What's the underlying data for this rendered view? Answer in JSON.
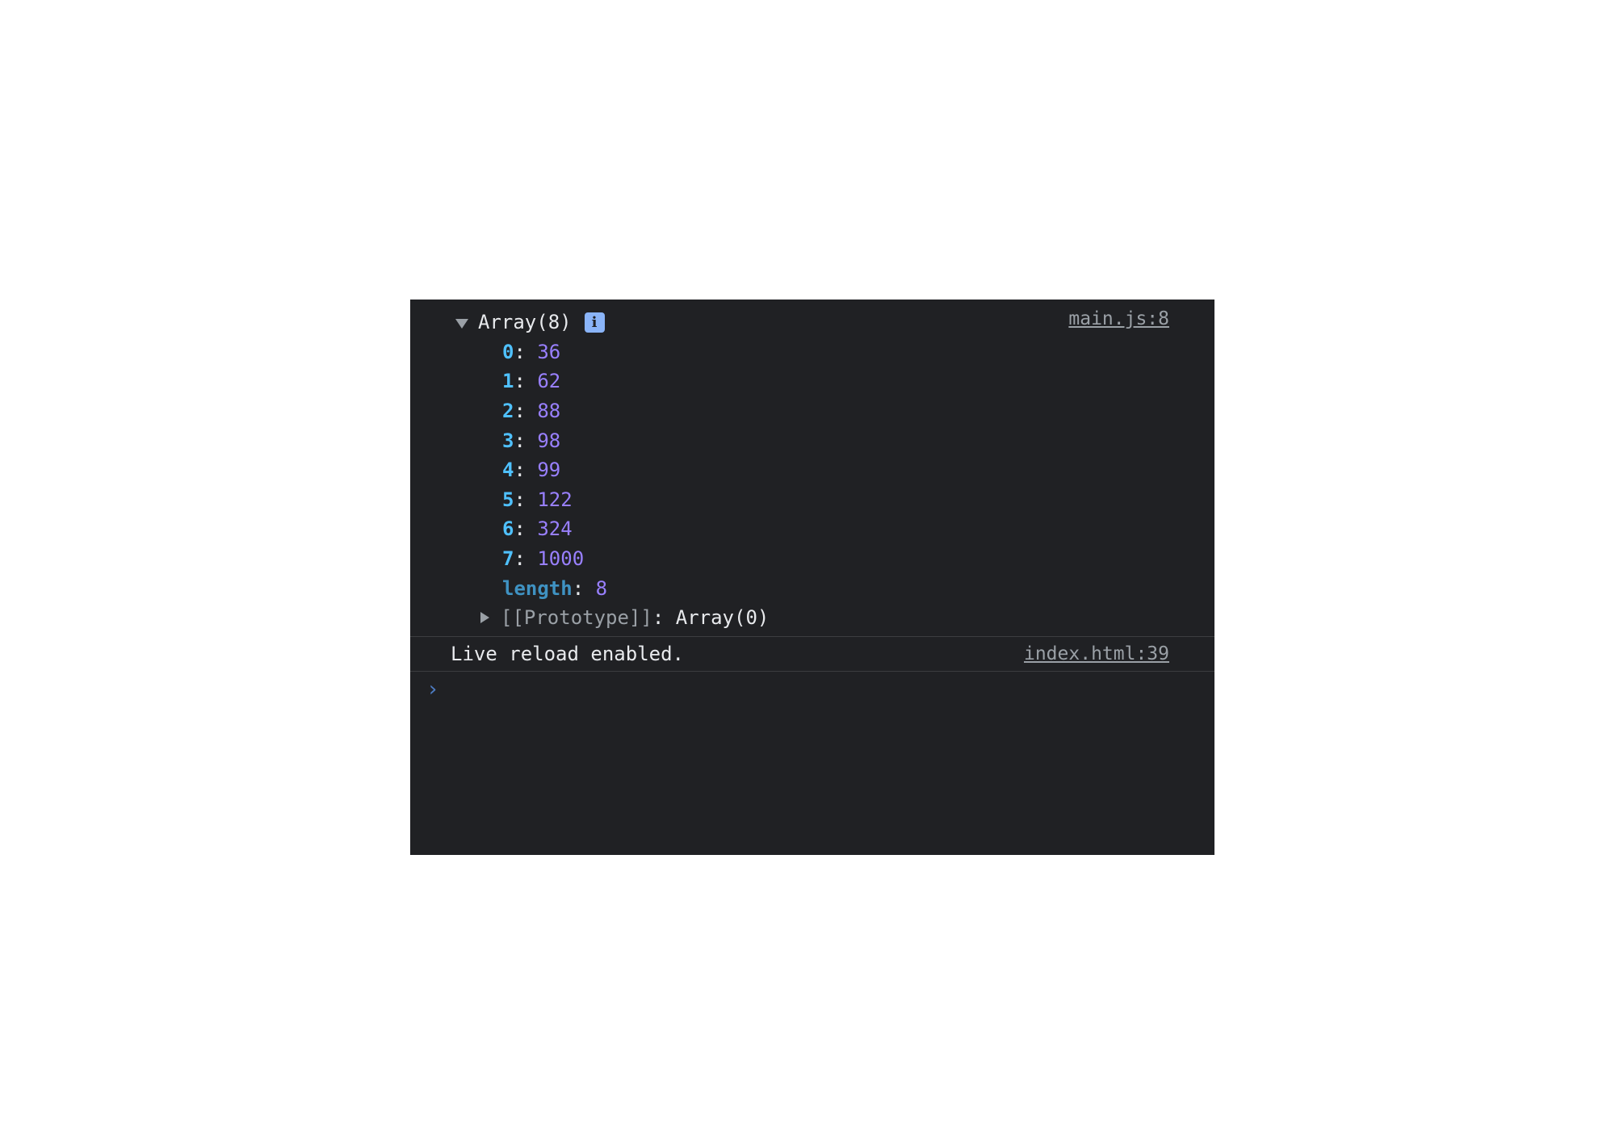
{
  "console": {
    "entries": [
      {
        "header_label": "Array(8)",
        "info_badge": "i",
        "source": "main.js:8",
        "items": [
          {
            "key": "0",
            "value": "36"
          },
          {
            "key": "1",
            "value": "62"
          },
          {
            "key": "2",
            "value": "88"
          },
          {
            "key": "3",
            "value": "98"
          },
          {
            "key": "4",
            "value": "99"
          },
          {
            "key": "5",
            "value": "122"
          },
          {
            "key": "6",
            "value": "324"
          },
          {
            "key": "7",
            "value": "1000"
          }
        ],
        "length_key": "length",
        "length_value": "8",
        "prototype_key": "[[Prototype]]",
        "prototype_value": "Array(0)"
      },
      {
        "message": "Live reload enabled.",
        "source": "index.html:39"
      }
    ],
    "prompt_symbol": "›",
    "colors": {
      "background": "#202124",
      "key": "#4fc1ff",
      "number": "#9980ff",
      "info_badge": "#8ab4f8",
      "prompt": "#4d7cc3"
    }
  }
}
